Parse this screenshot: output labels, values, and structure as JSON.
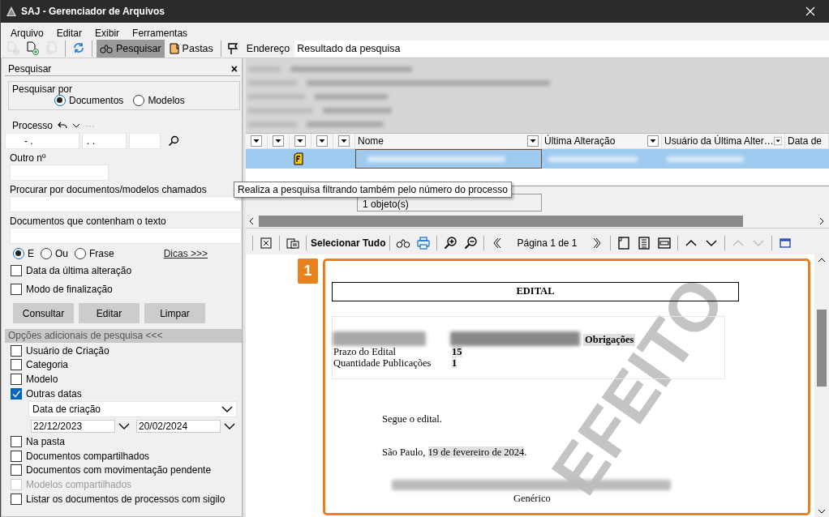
{
  "window": {
    "title": "SAJ - Gerenciador de Arquivos"
  },
  "menu": [
    {
      "label": "Arquivo"
    },
    {
      "label": "Editar"
    },
    {
      "label": "Exibir"
    },
    {
      "label": "Ferramentas"
    }
  ],
  "toolbar": {
    "buttons": [
      {
        "kind": "new-doc",
        "disabled": true
      },
      {
        "kind": "add-doc",
        "disabled": false
      },
      {
        "kind": "copy-doc",
        "disabled": true
      },
      {
        "kind": "refresh",
        "disabled": false
      }
    ],
    "tabs": [
      {
        "label": "Pesquisar",
        "selected": true
      },
      {
        "label": "Pastas",
        "selected": false
      }
    ],
    "address_label": "Endereço",
    "address_value": "Resultado da pesquisa"
  },
  "search_panel": {
    "title": "Pesquisar",
    "close": "×",
    "search_by": {
      "label": "Pesquisar por",
      "options": [
        {
          "label": "Documentos",
          "selected": true
        },
        {
          "label": "Modelos",
          "selected": false
        }
      ]
    },
    "process": {
      "label": "Processo",
      "more": "···",
      "mask_values": [
        "-  .",
        ".  ."
      ]
    },
    "other_number": {
      "label": "Outro nº"
    },
    "named": {
      "label": "Procurar por documentos/modelos chamados"
    },
    "text": {
      "label": "Documentos que contenham o texto"
    },
    "match_modes": [
      {
        "label": "E",
        "selected": true
      },
      {
        "label": "Ou",
        "selected": false
      },
      {
        "label": "Frase",
        "selected": false
      }
    ],
    "tips_link": "Dicas >>>",
    "filters": [
      {
        "label": "Data da última alteração",
        "checked": false
      },
      {
        "label": "Modo de finalização",
        "checked": false
      }
    ],
    "buttons": [
      {
        "label": "Consultar"
      },
      {
        "label": "Editar"
      },
      {
        "label": "Limpar"
      }
    ],
    "additional": {
      "title": "Opções adicionais de pesquisa <<<",
      "options": [
        {
          "kind": "checkbox",
          "label": "Usuário de Criação",
          "checked": false,
          "disabled": false
        },
        {
          "kind": "checkbox",
          "label": "Categoria",
          "checked": false,
          "disabled": false
        },
        {
          "kind": "checkbox",
          "label": "Modelo",
          "checked": false,
          "disabled": false
        },
        {
          "kind": "dates",
          "label": "Outras datas",
          "checked": true,
          "disabled": false,
          "date_type": "Data de criação",
          "from": "22/12/2023",
          "to": "20/02/2024"
        },
        {
          "kind": "checkbox",
          "label": "Na pasta",
          "checked": false,
          "disabled": false
        },
        {
          "kind": "checkbox",
          "label": "Documentos compartilhados",
          "checked": false,
          "disabled": false
        },
        {
          "kind": "checkbox",
          "label": "Documentos com movimentação pendente",
          "checked": false,
          "disabled": false
        },
        {
          "kind": "checkbox",
          "label": "Modelos compartilhados",
          "checked": false,
          "disabled": true
        },
        {
          "kind": "checkbox",
          "label": "Listar os documentos de processos com sigilo",
          "checked": false,
          "disabled": false
        }
      ]
    }
  },
  "grid": {
    "columns": [
      "Nome",
      "Última Alteração",
      "Usuário da Última Alter…",
      "Data de"
    ],
    "rows": [
      {
        "selected": true
      }
    ],
    "status": "1 objeto(s)"
  },
  "tooltip": "Realiza a pesquisa filtrando também pelo número do processo",
  "preview": {
    "select_all": "Selecionar Tudo",
    "page_label": "Página 1 de 1",
    "nav_buttons": [
      {
        "disabled": false
      },
      {
        "disabled": false
      },
      {
        "disabled": true
      },
      {
        "disabled": true
      }
    ],
    "badge": "1",
    "heading": "EDITAL",
    "table_header": "Obrigações",
    "table_rows": [
      [
        "Prazo do Edital",
        "15"
      ],
      [
        "Quantidade Publicações",
        "1"
      ]
    ],
    "paragraphs": [
      {
        "text": "Segue o edital."
      },
      {
        "text": "São Paulo, ",
        "field": "19 de fevereiro de 2024",
        "after": "."
      }
    ],
    "footer": "Genérico",
    "stamp": "EFEITO"
  }
}
